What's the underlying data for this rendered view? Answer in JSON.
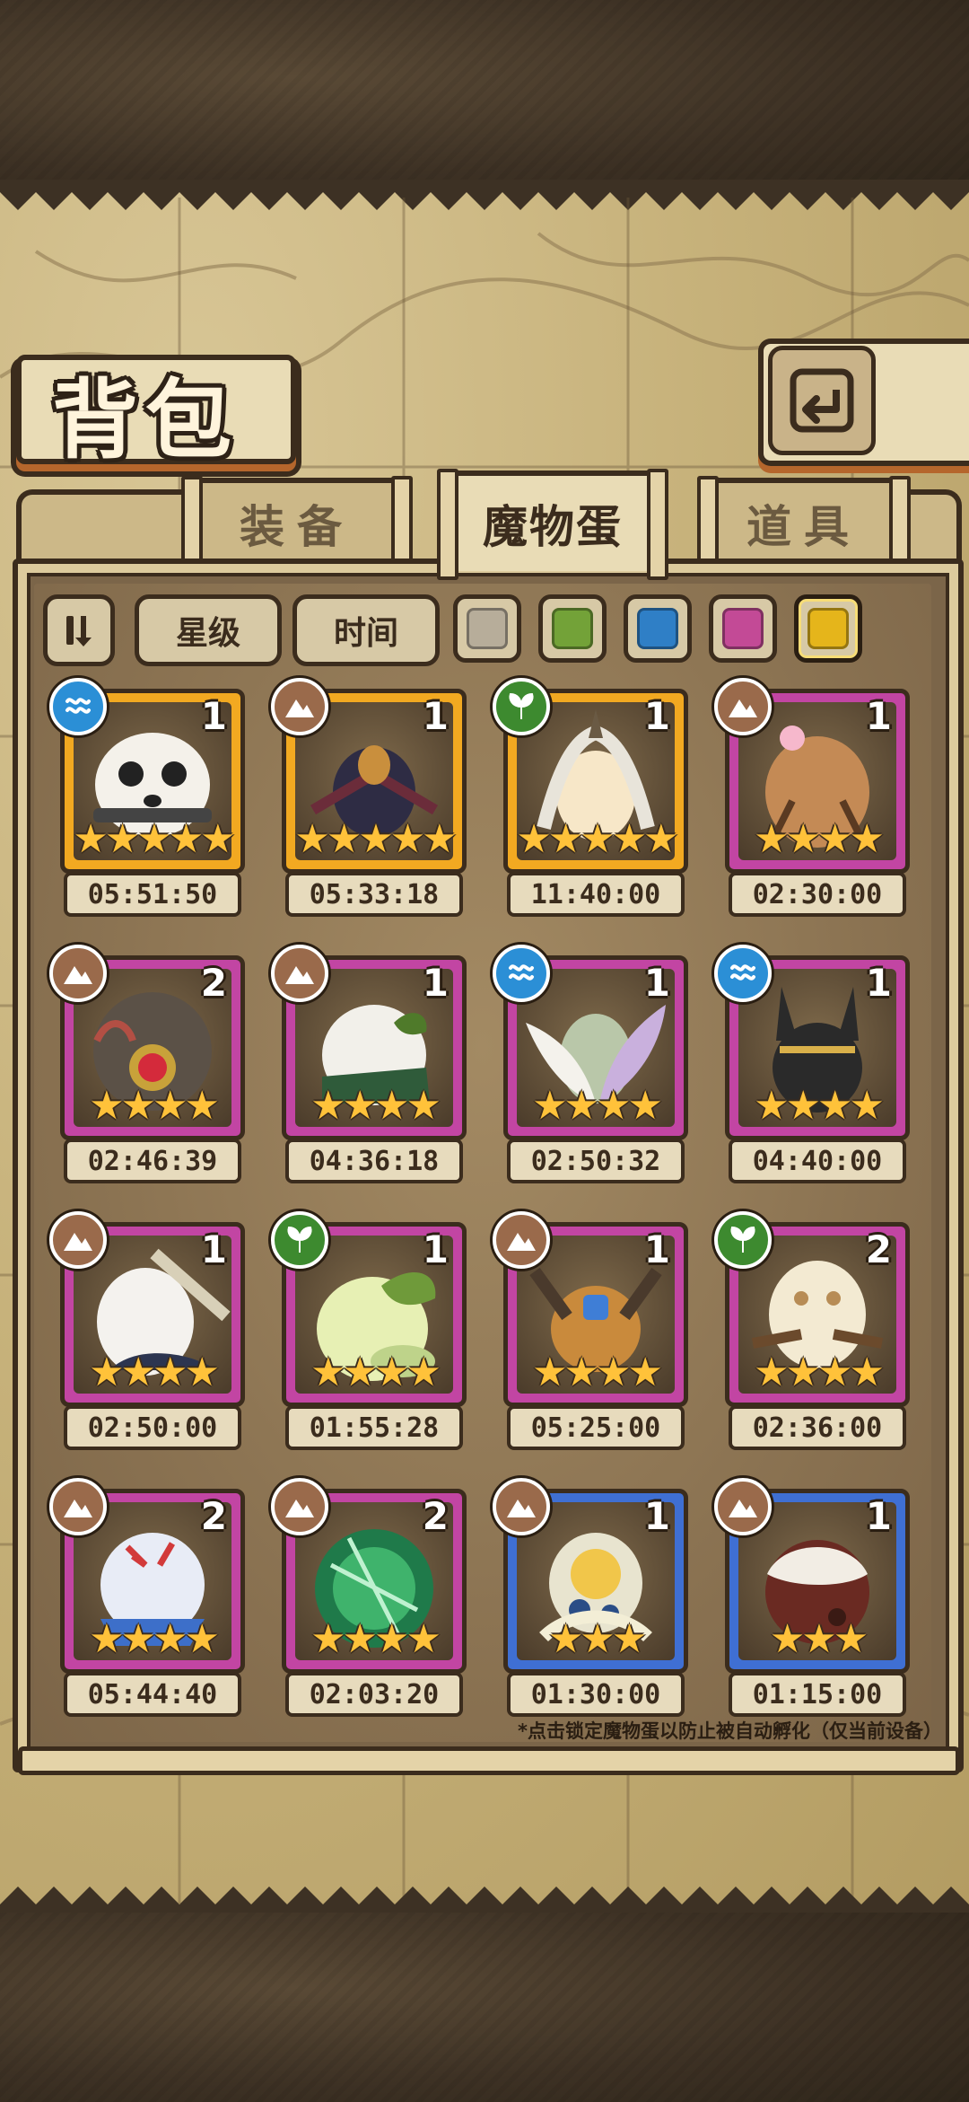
{
  "header": {
    "title": "背包",
    "back_icon": "return-icon"
  },
  "tabs": [
    {
      "label": "装备",
      "active": false
    },
    {
      "label": "魔物蛋",
      "active": true
    },
    {
      "label": "道具",
      "active": false
    }
  ],
  "filters": {
    "sort_icon": "sort-toggle-icon",
    "star_label": "星级",
    "time_label": "时间",
    "colors": [
      {
        "name": "gray",
        "hex": "#b7ad9a"
      },
      {
        "name": "green",
        "hex": "#73a238"
      },
      {
        "name": "blue",
        "hex": "#2f7fc6"
      },
      {
        "name": "pink",
        "hex": "#c34a96"
      },
      {
        "name": "gold",
        "hex": "#e5b51b"
      }
    ]
  },
  "eggs": [
    {
      "count": "1",
      "stars": "★★★★★",
      "time": "05:51:50",
      "rarity": "gold",
      "element": "water"
    },
    {
      "count": "1",
      "stars": "★★★★★",
      "time": "05:33:18",
      "rarity": "gold",
      "element": "earth"
    },
    {
      "count": "1",
      "stars": "★★★★★",
      "time": "11:40:00",
      "rarity": "gold",
      "element": "wood"
    },
    {
      "count": "1",
      "stars": "★★★★",
      "time": "02:30:00",
      "rarity": "pink",
      "element": "earth"
    },
    {
      "count": "2",
      "stars": "★★★★",
      "time": "02:46:39",
      "rarity": "pink",
      "element": "earth"
    },
    {
      "count": "1",
      "stars": "★★★★",
      "time": "04:36:18",
      "rarity": "pink",
      "element": "earth"
    },
    {
      "count": "1",
      "stars": "★★★★",
      "time": "02:50:32",
      "rarity": "pink",
      "element": "water"
    },
    {
      "count": "1",
      "stars": "★★★★",
      "time": "04:40:00",
      "rarity": "pink",
      "element": "water"
    },
    {
      "count": "1",
      "stars": "★★★★",
      "time": "02:50:00",
      "rarity": "pink",
      "element": "earth"
    },
    {
      "count": "1",
      "stars": "★★★★",
      "time": "01:55:28",
      "rarity": "pink",
      "element": "wood"
    },
    {
      "count": "1",
      "stars": "★★★★",
      "time": "05:25:00",
      "rarity": "pink",
      "element": "earth"
    },
    {
      "count": "2",
      "stars": "★★★★",
      "time": "02:36:00",
      "rarity": "pink",
      "element": "wood"
    },
    {
      "count": "2",
      "stars": "★★★★",
      "time": "05:44:40",
      "rarity": "pink",
      "element": "earth"
    },
    {
      "count": "2",
      "stars": "★★★★",
      "time": "02:03:20",
      "rarity": "pink",
      "element": "earth"
    },
    {
      "count": "1",
      "stars": "★★★",
      "time": "01:30:00",
      "rarity": "blue",
      "element": "earth"
    },
    {
      "count": "1",
      "stars": "★★★",
      "time": "01:15:00",
      "rarity": "blue",
      "element": "earth"
    }
  ],
  "palette": {
    "gold": "#f2a921",
    "pink": "#c245a3",
    "blue": "#3f6fd3",
    "water": "#2b8fd6",
    "earth": "#9a6a4b",
    "wood": "#3d8a2f"
  },
  "footer_note": "*点击锁定魔物蛋以防止被自动孵化（仅当前设备）"
}
